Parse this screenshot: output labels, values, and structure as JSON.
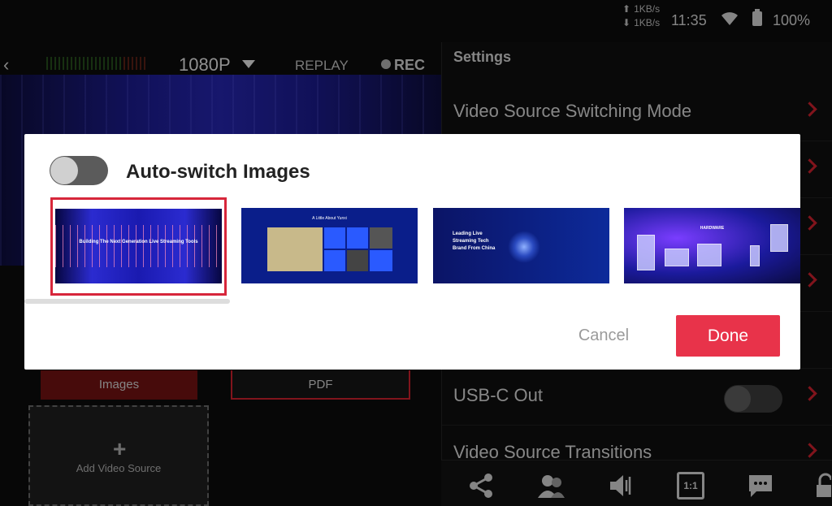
{
  "status": {
    "upload_speed": "1KB/s",
    "download_speed": "1KB/s",
    "up_arrow": "⬆",
    "down_arrow": "⬇",
    "time": "11:35",
    "battery": "100%"
  },
  "preview_header": {
    "back_icon": "‹",
    "resolution": "1080P",
    "replay": "REPLAY",
    "rec": "REC"
  },
  "sources": {
    "images_label": "Images",
    "pdf_label": "PDF",
    "add_plus": "+",
    "add_label": "Add Video Source"
  },
  "settings": {
    "title": "Settings",
    "rows": [
      {
        "label": "Video Source Switching Mode"
      },
      {
        "label": ""
      },
      {
        "label": ""
      },
      {
        "label": ""
      },
      {
        "label": ""
      },
      {
        "label": "USB-C Out"
      },
      {
        "label": "Video Source Transitions"
      }
    ],
    "usb_c_out_enabled": false
  },
  "toolbar": {
    "icons": [
      "share-icon",
      "guests-icon",
      "audio-icon",
      "aspect-ratio-icon",
      "chat-icon",
      "lock-icon"
    ],
    "aspect_label": "1:1"
  },
  "modal": {
    "title": "Auto-switch Images",
    "auto_switch_enabled": false,
    "thumbnails": [
      {
        "caption": "Building The Next Generation Live Streaming Tools",
        "selected": true
      },
      {
        "caption": "A Little About Yunxi",
        "selected": false
      },
      {
        "caption": "Leading Live Streaming Tech Brand From China",
        "selected": false
      },
      {
        "caption": "HARDWARE",
        "selected": false
      }
    ],
    "cancel_label": "Cancel",
    "done_label": "Done",
    "accent_color": "#e8334a"
  }
}
